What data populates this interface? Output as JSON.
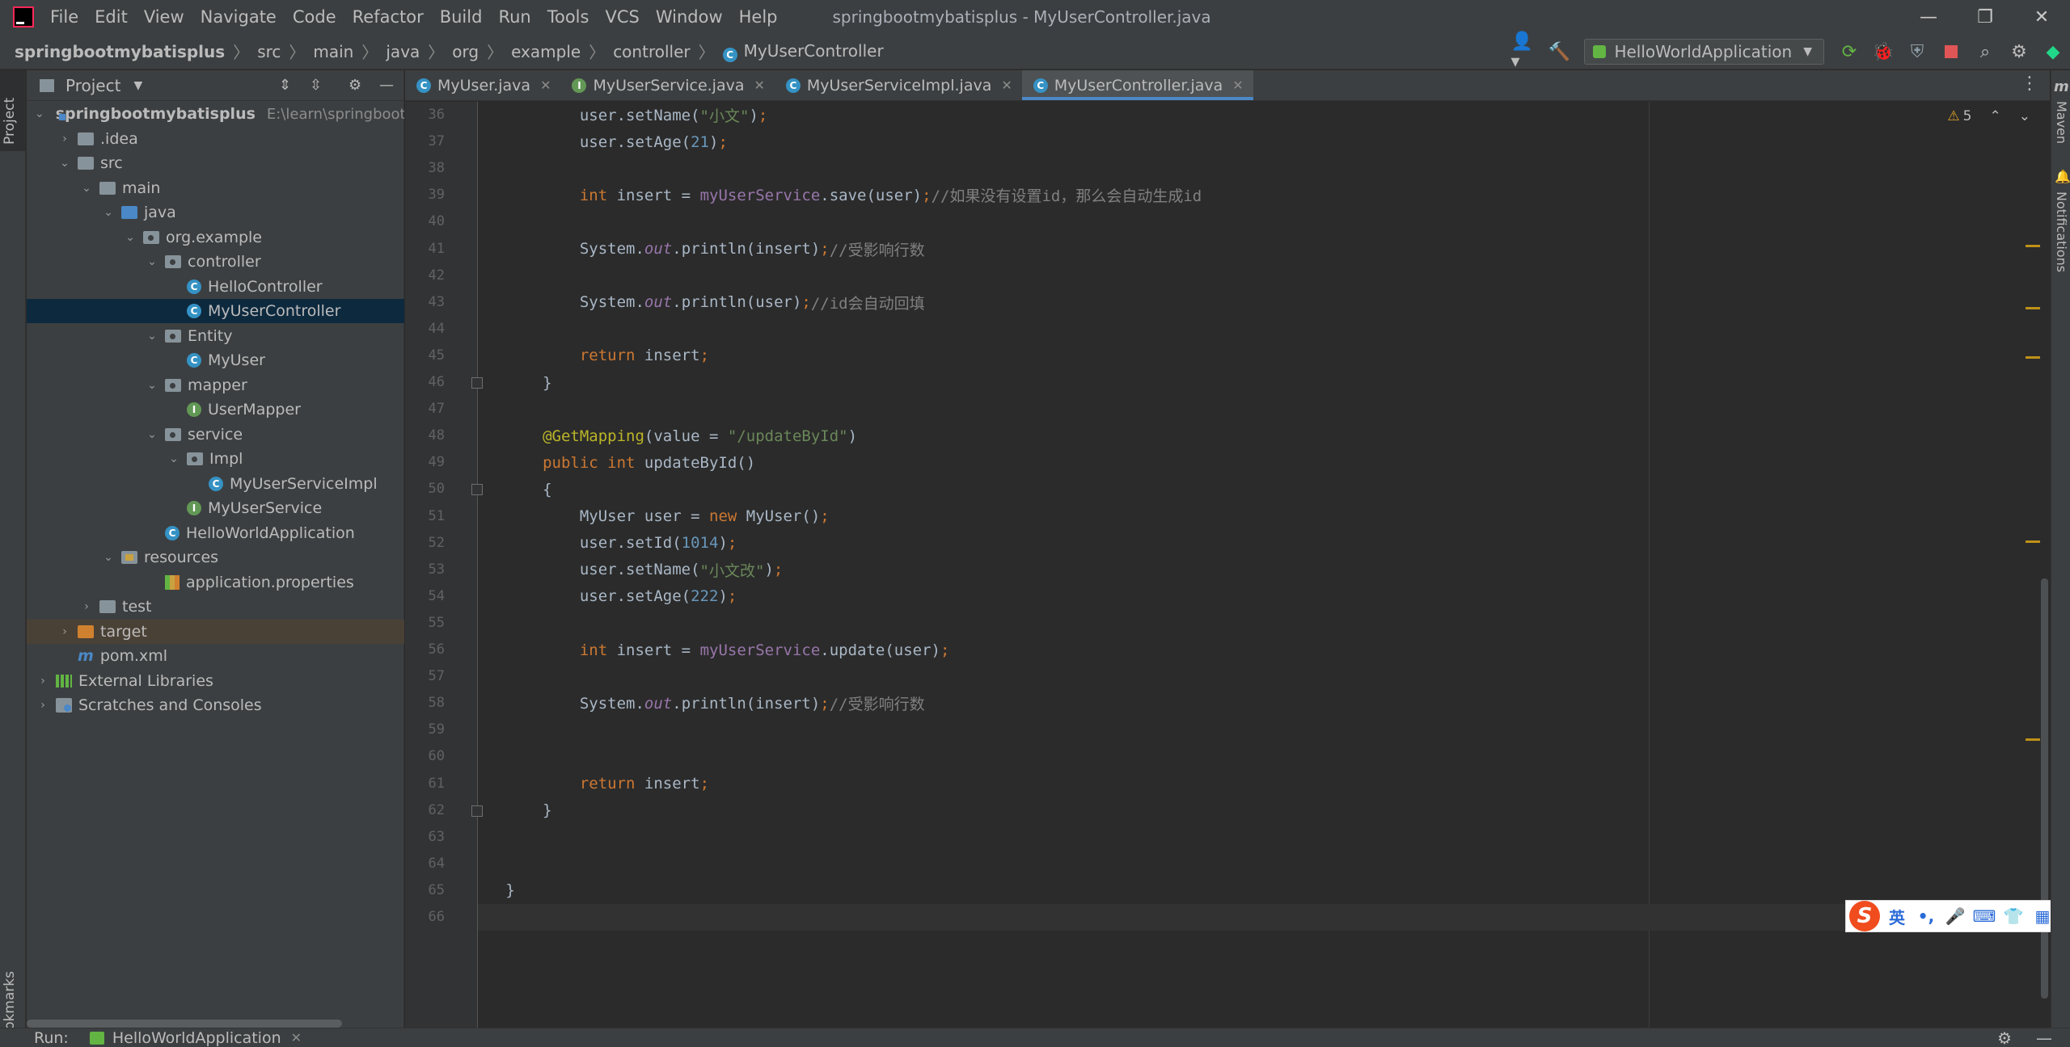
{
  "window": {
    "title": "springbootmybatisplus - MyUserController.java",
    "menu": [
      "File",
      "Edit",
      "View",
      "Navigate",
      "Code",
      "Refactor",
      "Build",
      "Run",
      "Tools",
      "VCS",
      "Window",
      "Help"
    ],
    "controls": {
      "minimize": "—",
      "restore": "❐",
      "close": "✕"
    }
  },
  "breadcrumbs": [
    "springbootmybatisplus",
    "src",
    "main",
    "java",
    "org",
    "example",
    "controller",
    "MyUserController"
  ],
  "toolbar": {
    "run_config": "HelloWorldApplication",
    "icons": [
      "user-icon",
      "build-hammer-icon",
      "rerun-icon",
      "debug-icon",
      "coverage-icon",
      "stop-icon",
      "search-icon",
      "settings-icon",
      "jetbrains-icon"
    ],
    "colors": {
      "build": "#62b543",
      "stop": "#e05555"
    }
  },
  "left_strip": {
    "project_label": "Project",
    "bookmarks_label": "Bookmarks"
  },
  "project_panel": {
    "title": "Project",
    "tree": [
      {
        "label": "springbootmybatisplus",
        "hint": "E:\\learn\\springbootm",
        "depth": 0,
        "chevron": "open",
        "icon": "module",
        "bold": true
      },
      {
        "label": ".idea",
        "depth": 1,
        "chevron": "closed",
        "icon": "folder"
      },
      {
        "label": "src",
        "depth": 1,
        "chevron": "open",
        "icon": "folder"
      },
      {
        "label": "main",
        "depth": 2,
        "chevron": "open",
        "icon": "folder"
      },
      {
        "label": "java",
        "depth": 3,
        "chevron": "open",
        "icon": "blue"
      },
      {
        "label": "org.example",
        "depth": 4,
        "chevron": "open",
        "icon": "pkg"
      },
      {
        "label": "controller",
        "depth": 5,
        "chevron": "open",
        "icon": "pkg"
      },
      {
        "label": "HelloController",
        "depth": 6,
        "chevron": "none",
        "icon": "class"
      },
      {
        "label": "MyUserController",
        "depth": 6,
        "chevron": "none",
        "icon": "class",
        "selected": true
      },
      {
        "label": "Entity",
        "depth": 5,
        "chevron": "open",
        "icon": "pkg"
      },
      {
        "label": "MyUser",
        "depth": 6,
        "chevron": "none",
        "icon": "class"
      },
      {
        "label": "mapper",
        "depth": 5,
        "chevron": "open",
        "icon": "pkg"
      },
      {
        "label": "UserMapper",
        "depth": 6,
        "chevron": "none",
        "icon": "interface"
      },
      {
        "label": "service",
        "depth": 5,
        "chevron": "open",
        "icon": "pkg"
      },
      {
        "label": "Impl",
        "depth": 6,
        "chevron": "open",
        "icon": "pkg"
      },
      {
        "label": "MyUserServiceImpl",
        "depth": 7,
        "chevron": "none",
        "icon": "class"
      },
      {
        "label": "MyUserService",
        "depth": 6,
        "chevron": "none",
        "icon": "interface"
      },
      {
        "label": "HelloWorldApplication",
        "depth": 5,
        "chevron": "none",
        "icon": "class"
      },
      {
        "label": "resources",
        "depth": 3,
        "chevron": "open",
        "icon": "res"
      },
      {
        "label": "application.properties",
        "depth": 5,
        "chevron": "none",
        "icon": "props"
      },
      {
        "label": "test",
        "depth": 2,
        "chevron": "closed",
        "icon": "folder"
      },
      {
        "label": "target",
        "depth": 1,
        "chevron": "closed",
        "icon": "orange",
        "excluded": true
      },
      {
        "label": "pom.xml",
        "depth": 1,
        "chevron": "none",
        "icon": "maven"
      },
      {
        "label": "External Libraries",
        "depth": 0,
        "chevron": "closed",
        "icon": "lib"
      },
      {
        "label": "Scratches and Consoles",
        "depth": 0,
        "chevron": "closed",
        "icon": "scratch"
      }
    ]
  },
  "editor_tabs": [
    {
      "label": "MyUser.java",
      "icon": "class",
      "active": false
    },
    {
      "label": "MyUserService.java",
      "icon": "interface",
      "active": false
    },
    {
      "label": "MyUserServiceImpl.java",
      "icon": "class",
      "active": false
    },
    {
      "label": "MyUserController.java",
      "icon": "class",
      "active": true
    }
  ],
  "editor": {
    "warnings_count": "5",
    "current_line": 66,
    "lines": [
      {
        "n": "36",
        "tokens": [
          [
            "t",
            "        user.setName("
          ],
          [
            "s",
            "\"小文\""
          ],
          [
            "t",
            ")"
          ],
          [
            "k",
            ";"
          ]
        ]
      },
      {
        "n": "37",
        "tokens": [
          [
            "t",
            "        user.setAge("
          ],
          [
            "n",
            "21"
          ],
          [
            "t",
            ")"
          ],
          [
            "k",
            ";"
          ]
        ]
      },
      {
        "n": "38",
        "tokens": []
      },
      {
        "n": "39",
        "tokens": [
          [
            "k",
            "        int "
          ],
          [
            "t",
            "insert = "
          ],
          [
            "f",
            "myUserService"
          ],
          [
            "t",
            ".save(user)"
          ],
          [
            "k",
            ";"
          ],
          [
            "c",
            "//如果没有设置id，那么会自动生成id"
          ]
        ]
      },
      {
        "n": "40",
        "tokens": []
      },
      {
        "n": "41",
        "tokens": [
          [
            "t",
            "        System."
          ],
          [
            "fi",
            "out"
          ],
          [
            "t",
            ".println(insert)"
          ],
          [
            "k",
            ";"
          ],
          [
            "c",
            "//受影响行数"
          ]
        ]
      },
      {
        "n": "42",
        "tokens": []
      },
      {
        "n": "43",
        "tokens": [
          [
            "t",
            "        System."
          ],
          [
            "fi",
            "out"
          ],
          [
            "t",
            ".println(user)"
          ],
          [
            "k",
            ";"
          ],
          [
            "c",
            "//id会自动回填"
          ]
        ]
      },
      {
        "n": "44",
        "tokens": []
      },
      {
        "n": "45",
        "tokens": [
          [
            "k",
            "        return "
          ],
          [
            "t",
            "insert"
          ],
          [
            "k",
            ";"
          ]
        ]
      },
      {
        "n": "46",
        "tokens": [
          [
            "t",
            "    }"
          ]
        ],
        "fold": true
      },
      {
        "n": "47",
        "tokens": []
      },
      {
        "n": "48",
        "tokens": [
          [
            "an",
            "    @GetMapping"
          ],
          [
            "t",
            "(value = "
          ],
          [
            "s",
            "\"/updateById\""
          ],
          [
            "t",
            ")"
          ]
        ]
      },
      {
        "n": "49",
        "tokens": [
          [
            "k",
            "    public int "
          ],
          [
            "t",
            "updateById()"
          ]
        ]
      },
      {
        "n": "50",
        "tokens": [
          [
            "t",
            "    {"
          ]
        ],
        "fold": true
      },
      {
        "n": "51",
        "tokens": [
          [
            "t",
            "        MyUser user = "
          ],
          [
            "k",
            "new "
          ],
          [
            "t",
            "MyUser()"
          ],
          [
            "k",
            ";"
          ]
        ]
      },
      {
        "n": "52",
        "tokens": [
          [
            "t",
            "        user.setId("
          ],
          [
            "n",
            "1014"
          ],
          [
            "t",
            ")"
          ],
          [
            "k",
            ";"
          ]
        ]
      },
      {
        "n": "53",
        "tokens": [
          [
            "t",
            "        user.setName("
          ],
          [
            "s",
            "\"小文改\""
          ],
          [
            "t",
            ")"
          ],
          [
            "k",
            ";"
          ]
        ]
      },
      {
        "n": "54",
        "tokens": [
          [
            "t",
            "        user.setAge("
          ],
          [
            "n",
            "222"
          ],
          [
            "t",
            ")"
          ],
          [
            "k",
            ";"
          ]
        ]
      },
      {
        "n": "55",
        "tokens": []
      },
      {
        "n": "56",
        "tokens": [
          [
            "k",
            "        int "
          ],
          [
            "t",
            "insert = "
          ],
          [
            "f",
            "myUserService"
          ],
          [
            "t",
            ".update(user)"
          ],
          [
            "k",
            ";"
          ]
        ]
      },
      {
        "n": "57",
        "tokens": []
      },
      {
        "n": "58",
        "tokens": [
          [
            "t",
            "        System."
          ],
          [
            "fi",
            "out"
          ],
          [
            "t",
            ".println(insert)"
          ],
          [
            "k",
            ";"
          ],
          [
            "c",
            "//受影响行数"
          ]
        ]
      },
      {
        "n": "59",
        "tokens": []
      },
      {
        "n": "60",
        "tokens": []
      },
      {
        "n": "61",
        "tokens": [
          [
            "k",
            "        return "
          ],
          [
            "t",
            "insert"
          ],
          [
            "k",
            ";"
          ]
        ]
      },
      {
        "n": "62",
        "tokens": [
          [
            "t",
            "    }"
          ]
        ],
        "fold": true
      },
      {
        "n": "63",
        "tokens": []
      },
      {
        "n": "64",
        "tokens": []
      },
      {
        "n": "65",
        "tokens": [
          [
            "t",
            "}"
          ]
        ]
      },
      {
        "n": "66",
        "tokens": []
      }
    ]
  },
  "right_strip": {
    "maven_label": "Maven",
    "notifications_label": "Notifications"
  },
  "ime": {
    "logo": "S",
    "lang": "英",
    "items": [
      "•,",
      "🎤",
      "⌨",
      "👕",
      "▦"
    ]
  },
  "bottom": {
    "run_label": "Run:",
    "run_tab": "HelloWorldApplication"
  }
}
